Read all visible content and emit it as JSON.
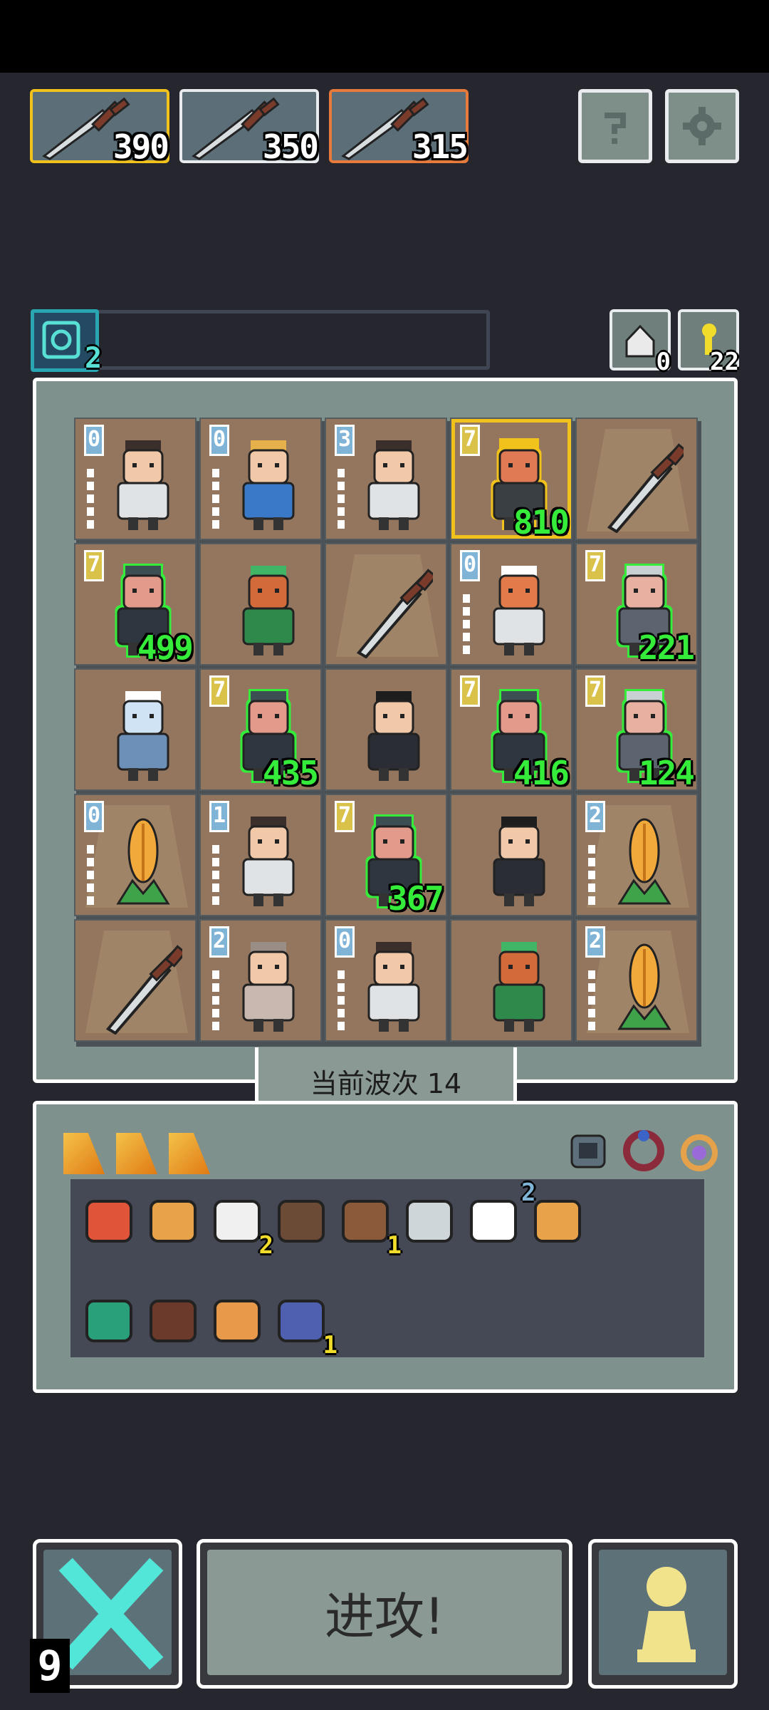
{
  "weapons": [
    {
      "value": "390",
      "border": "#f1c21b"
    },
    {
      "value": "350",
      "border": "#e8ecee"
    },
    {
      "value": "315",
      "border": "#e87a3c"
    }
  ],
  "buttons": {
    "help_icon": "question-icon",
    "settings_icon": "gear-icon"
  },
  "progress": {
    "level": "2"
  },
  "counters": {
    "undo": "0",
    "keys": "22"
  },
  "board": {
    "cells": [
      {
        "kind": "monk",
        "stars": "0"
      },
      {
        "kind": "farmer",
        "stars": "0"
      },
      {
        "kind": "monk",
        "stars": "3"
      },
      {
        "kind": "ogre",
        "stars": "7",
        "dmg": "810",
        "outline": "yellow"
      },
      {
        "kind": "sword"
      },
      {
        "kind": "warrior",
        "stars": "7",
        "dmg": "499",
        "outline": "green"
      },
      {
        "kind": "treant"
      },
      {
        "kind": "sword"
      },
      {
        "kind": "boar",
        "stars": "0"
      },
      {
        "kind": "elder",
        "stars": "7",
        "dmg": "221",
        "outline": "green"
      },
      {
        "kind": "yeti"
      },
      {
        "kind": "warrior",
        "stars": "7",
        "dmg": "435",
        "outline": "green"
      },
      {
        "kind": "scholar"
      },
      {
        "kind": "warrior",
        "stars": "7",
        "dmg": "416",
        "outline": "green"
      },
      {
        "kind": "elder",
        "stars": "7",
        "dmg": "124",
        "outline": "green"
      },
      {
        "kind": "wheat",
        "stars": "0"
      },
      {
        "kind": "monk",
        "stars": "1"
      },
      {
        "kind": "warrior",
        "stars": "7",
        "dmg": "367",
        "outline": "green"
      },
      {
        "kind": "scholar"
      },
      {
        "kind": "wheat",
        "stars": "2"
      },
      {
        "kind": "sword"
      },
      {
        "kind": "swordsman",
        "stars": "2"
      },
      {
        "kind": "monk",
        "stars": "0"
      },
      {
        "kind": "treant"
      },
      {
        "kind": "wheat",
        "stars": "2"
      }
    ]
  },
  "wave": {
    "label": "当前波次 14"
  },
  "inventory": {
    "items": [
      {
        "icon": "fire-bread-icon"
      },
      {
        "icon": "rabbit-icon"
      },
      {
        "icon": "cloud-icon",
        "count": "2"
      },
      {
        "icon": "spike-trap-icon"
      },
      {
        "icon": "magic-staff-icon",
        "count": "1"
      },
      {
        "icon": "dagger-icon"
      },
      {
        "icon": "milk-jar-icon"
      },
      {
        "icon": "gourd-icon",
        "count": "2"
      },
      {
        "icon": "bench-icon"
      },
      {
        "icon": "abacus-icon"
      },
      {
        "icon": "donut-icon"
      },
      {
        "icon": "pagoda-icon",
        "count": "1"
      }
    ]
  },
  "actions": {
    "attack": "进攻!",
    "turns": "9"
  }
}
